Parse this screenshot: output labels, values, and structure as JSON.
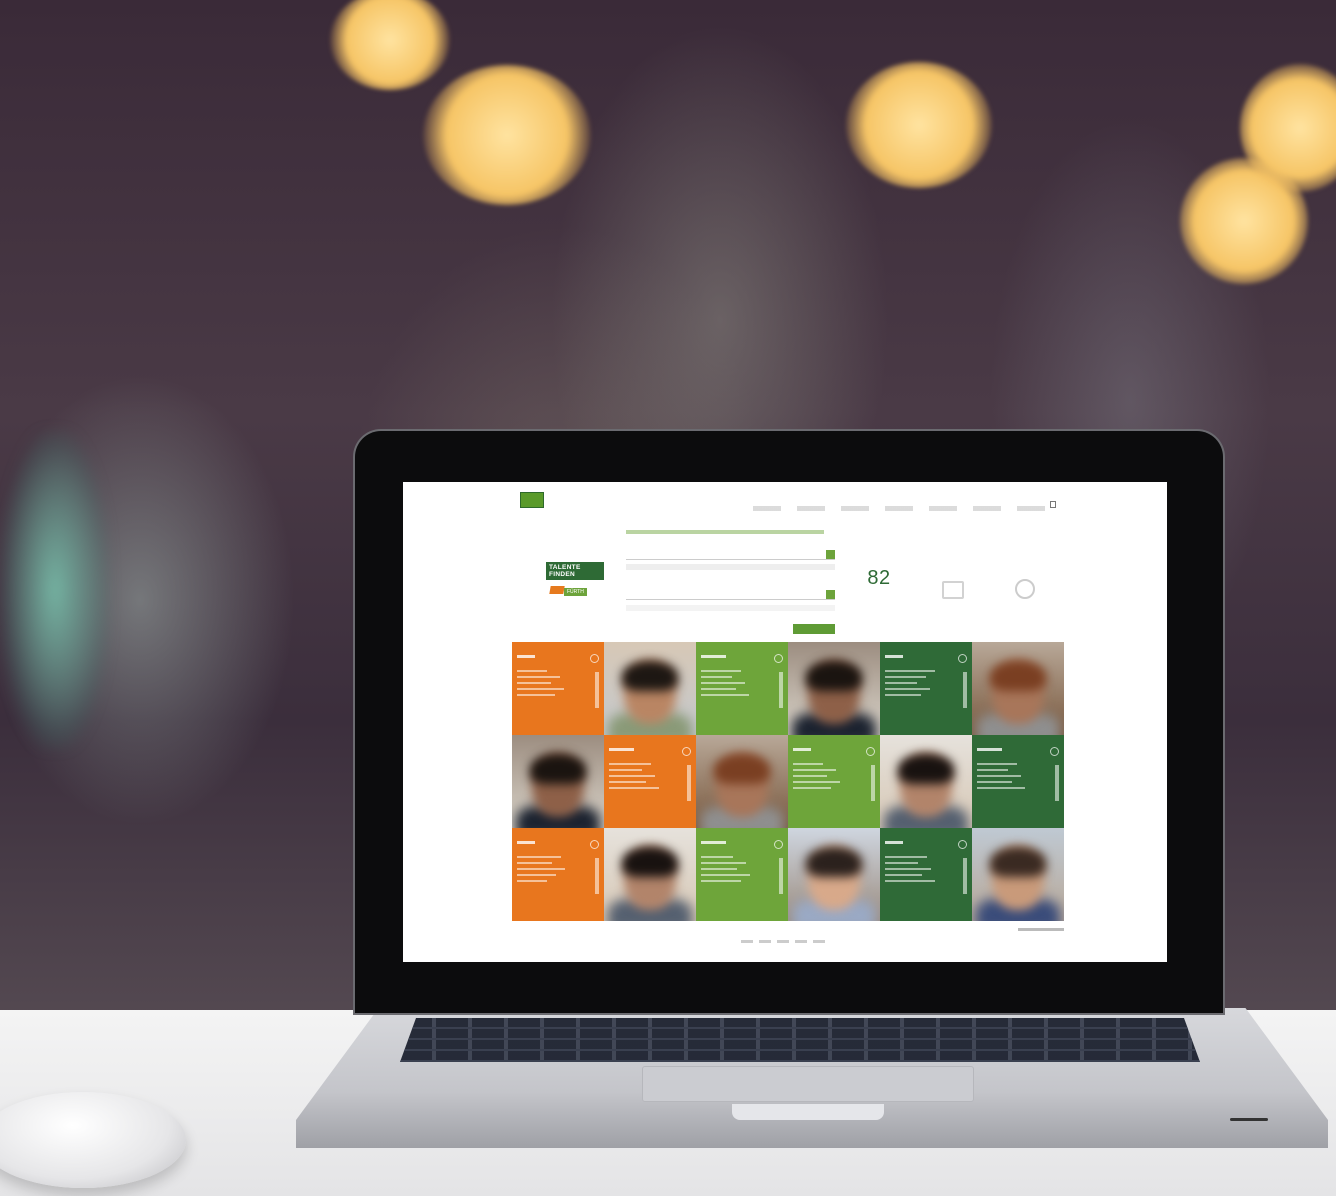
{
  "site": {
    "logo_text": "TALENTE FINDEN",
    "logo_sub": "FÜRTH",
    "small_logo_caption": "",
    "nav": [
      "",
      "",
      "",
      "",
      "",
      ""
    ]
  },
  "search": {
    "heading": "",
    "field1_label": "",
    "field1_value": "",
    "field2_label": "",
    "field2_value": "",
    "button_label": ""
  },
  "stats": {
    "count_label": "",
    "count_value": "82",
    "icon_names": [
      "check-mail-icon",
      "power-icon"
    ]
  },
  "colors": {
    "orange": "#e8761e",
    "light_green": "#6ea53a",
    "dark_green": "#2f6a37"
  },
  "grid": {
    "rows": [
      [
        {
          "kind": "tile",
          "color": "orange",
          "name": ""
        },
        {
          "kind": "photo"
        },
        {
          "kind": "tile",
          "color": "lgreen",
          "name": ""
        },
        {
          "kind": "photo"
        },
        {
          "kind": "tile",
          "color": "dgreen",
          "name": ""
        },
        {
          "kind": "photo"
        }
      ],
      [
        {
          "kind": "photo"
        },
        {
          "kind": "tile",
          "color": "orange",
          "name": ""
        },
        {
          "kind": "photo"
        },
        {
          "kind": "tile",
          "color": "lgreen",
          "name": ""
        },
        {
          "kind": "photo"
        },
        {
          "kind": "tile",
          "color": "dgreen",
          "name": ""
        }
      ],
      [
        {
          "kind": "tile",
          "color": "orange",
          "name": ""
        },
        {
          "kind": "photo"
        },
        {
          "kind": "tile",
          "color": "lgreen",
          "name": ""
        },
        {
          "kind": "photo"
        },
        {
          "kind": "tile",
          "color": "dgreen",
          "name": ""
        },
        {
          "kind": "photo"
        }
      ]
    ]
  },
  "pagination": {
    "items": [
      "",
      "",
      "",
      "",
      ""
    ],
    "sub": "",
    "more": ""
  }
}
